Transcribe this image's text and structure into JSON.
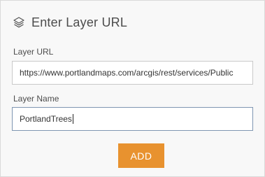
{
  "header": {
    "icon": "layers-icon",
    "title": "Enter Layer URL"
  },
  "layer_url": {
    "label": "Layer URL",
    "value": "https://www.portlandmaps.com/arcgis/rest/services/Public"
  },
  "layer_name": {
    "label": "Layer Name",
    "value": "PortlandTrees"
  },
  "add_button": {
    "label": "ADD",
    "color": "#e8922f"
  }
}
